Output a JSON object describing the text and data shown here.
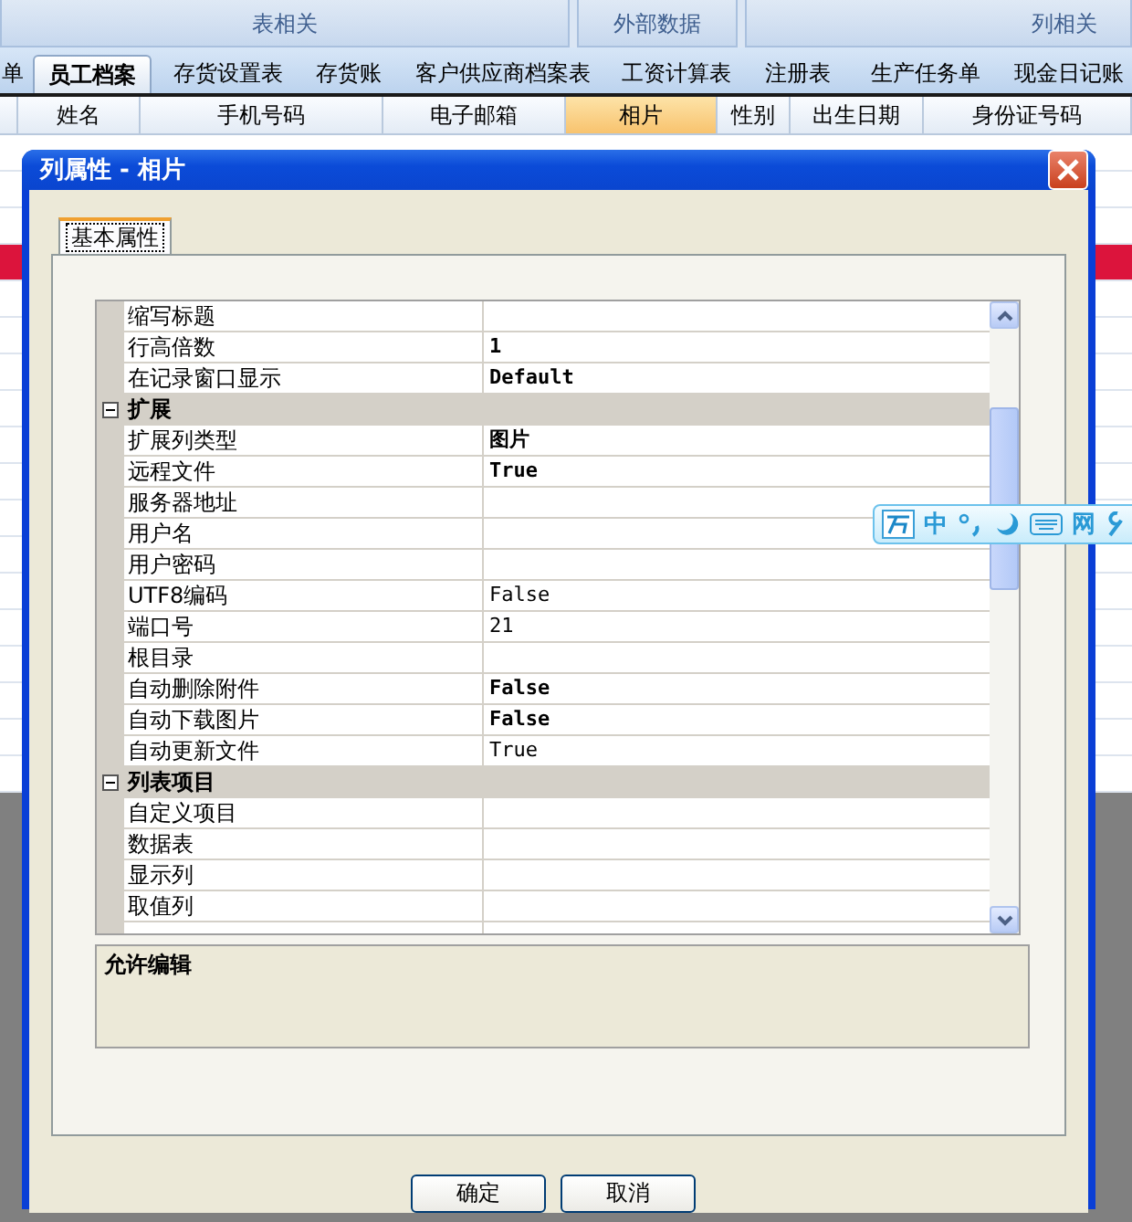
{
  "ribbon_groups": [
    {
      "label": "表相关"
    },
    {
      "label": "外部数据"
    },
    {
      "label": "列相关"
    }
  ],
  "tabs": [
    {
      "label": "单",
      "selected": false
    },
    {
      "label": "员工档案",
      "selected": true
    },
    {
      "label": "存货设置表",
      "selected": false
    },
    {
      "label": "存货账",
      "selected": false
    },
    {
      "label": "客户供应商档案表",
      "selected": false
    },
    {
      "label": "工资计算表",
      "selected": false
    },
    {
      "label": "注册表",
      "selected": false
    },
    {
      "label": "生产任务单",
      "selected": false
    },
    {
      "label": "现金日记账",
      "selected": false
    }
  ],
  "table": {
    "columns": [
      {
        "label": "姓名",
        "selected": false
      },
      {
        "label": "手机号码",
        "selected": false
      },
      {
        "label": "电子邮箱",
        "selected": false
      },
      {
        "label": "相片",
        "selected": true
      },
      {
        "label": "性别",
        "selected": false
      },
      {
        "label": "出生日期",
        "selected": false
      },
      {
        "label": "身份证号码",
        "selected": false
      }
    ]
  },
  "dialog": {
    "title": "列属性 - 相片",
    "tabs": [
      {
        "label": "基本属性",
        "selected": true
      }
    ],
    "properties": [
      {
        "kind": "item",
        "name": "缩写标题"
      },
      {
        "kind": "item",
        "name": "行高倍数",
        "value": "1",
        "bold": true
      },
      {
        "kind": "item",
        "name": "在记录窗口显示",
        "value": "Default",
        "bold": true
      },
      {
        "kind": "category",
        "name": "扩展",
        "expanded": true
      },
      {
        "kind": "item",
        "name": "扩展列类型",
        "value": "图片",
        "bold": true
      },
      {
        "kind": "item",
        "name": "远程文件",
        "value": "True",
        "bold": true
      },
      {
        "kind": "item",
        "name": "服务器地址"
      },
      {
        "kind": "item",
        "name": "用户名"
      },
      {
        "kind": "item",
        "name": "用户密码"
      },
      {
        "kind": "item",
        "name": "UTF8编码",
        "value": "False",
        "bold": false
      },
      {
        "kind": "item",
        "name": "端口号",
        "value": "21",
        "bold": false
      },
      {
        "kind": "item",
        "name": "根目录"
      },
      {
        "kind": "item",
        "name": "自动删除附件",
        "value": "False",
        "bold": true
      },
      {
        "kind": "item",
        "name": "自动下载图片",
        "value": "False",
        "bold": true
      },
      {
        "kind": "item",
        "name": "自动更新文件",
        "value": "True",
        "bold": false
      },
      {
        "kind": "category",
        "name": "列表项目",
        "expanded": true
      },
      {
        "kind": "item",
        "name": "自定义项目"
      },
      {
        "kind": "item",
        "name": "数据表"
      },
      {
        "kind": "item",
        "name": "显示列"
      },
      {
        "kind": "item",
        "name": "取值列"
      }
    ],
    "description": "允许编辑",
    "buttons": [
      "确定",
      "取消"
    ]
  },
  "ime_toolbar": {
    "labels": [
      "中",
      "网"
    ]
  }
}
